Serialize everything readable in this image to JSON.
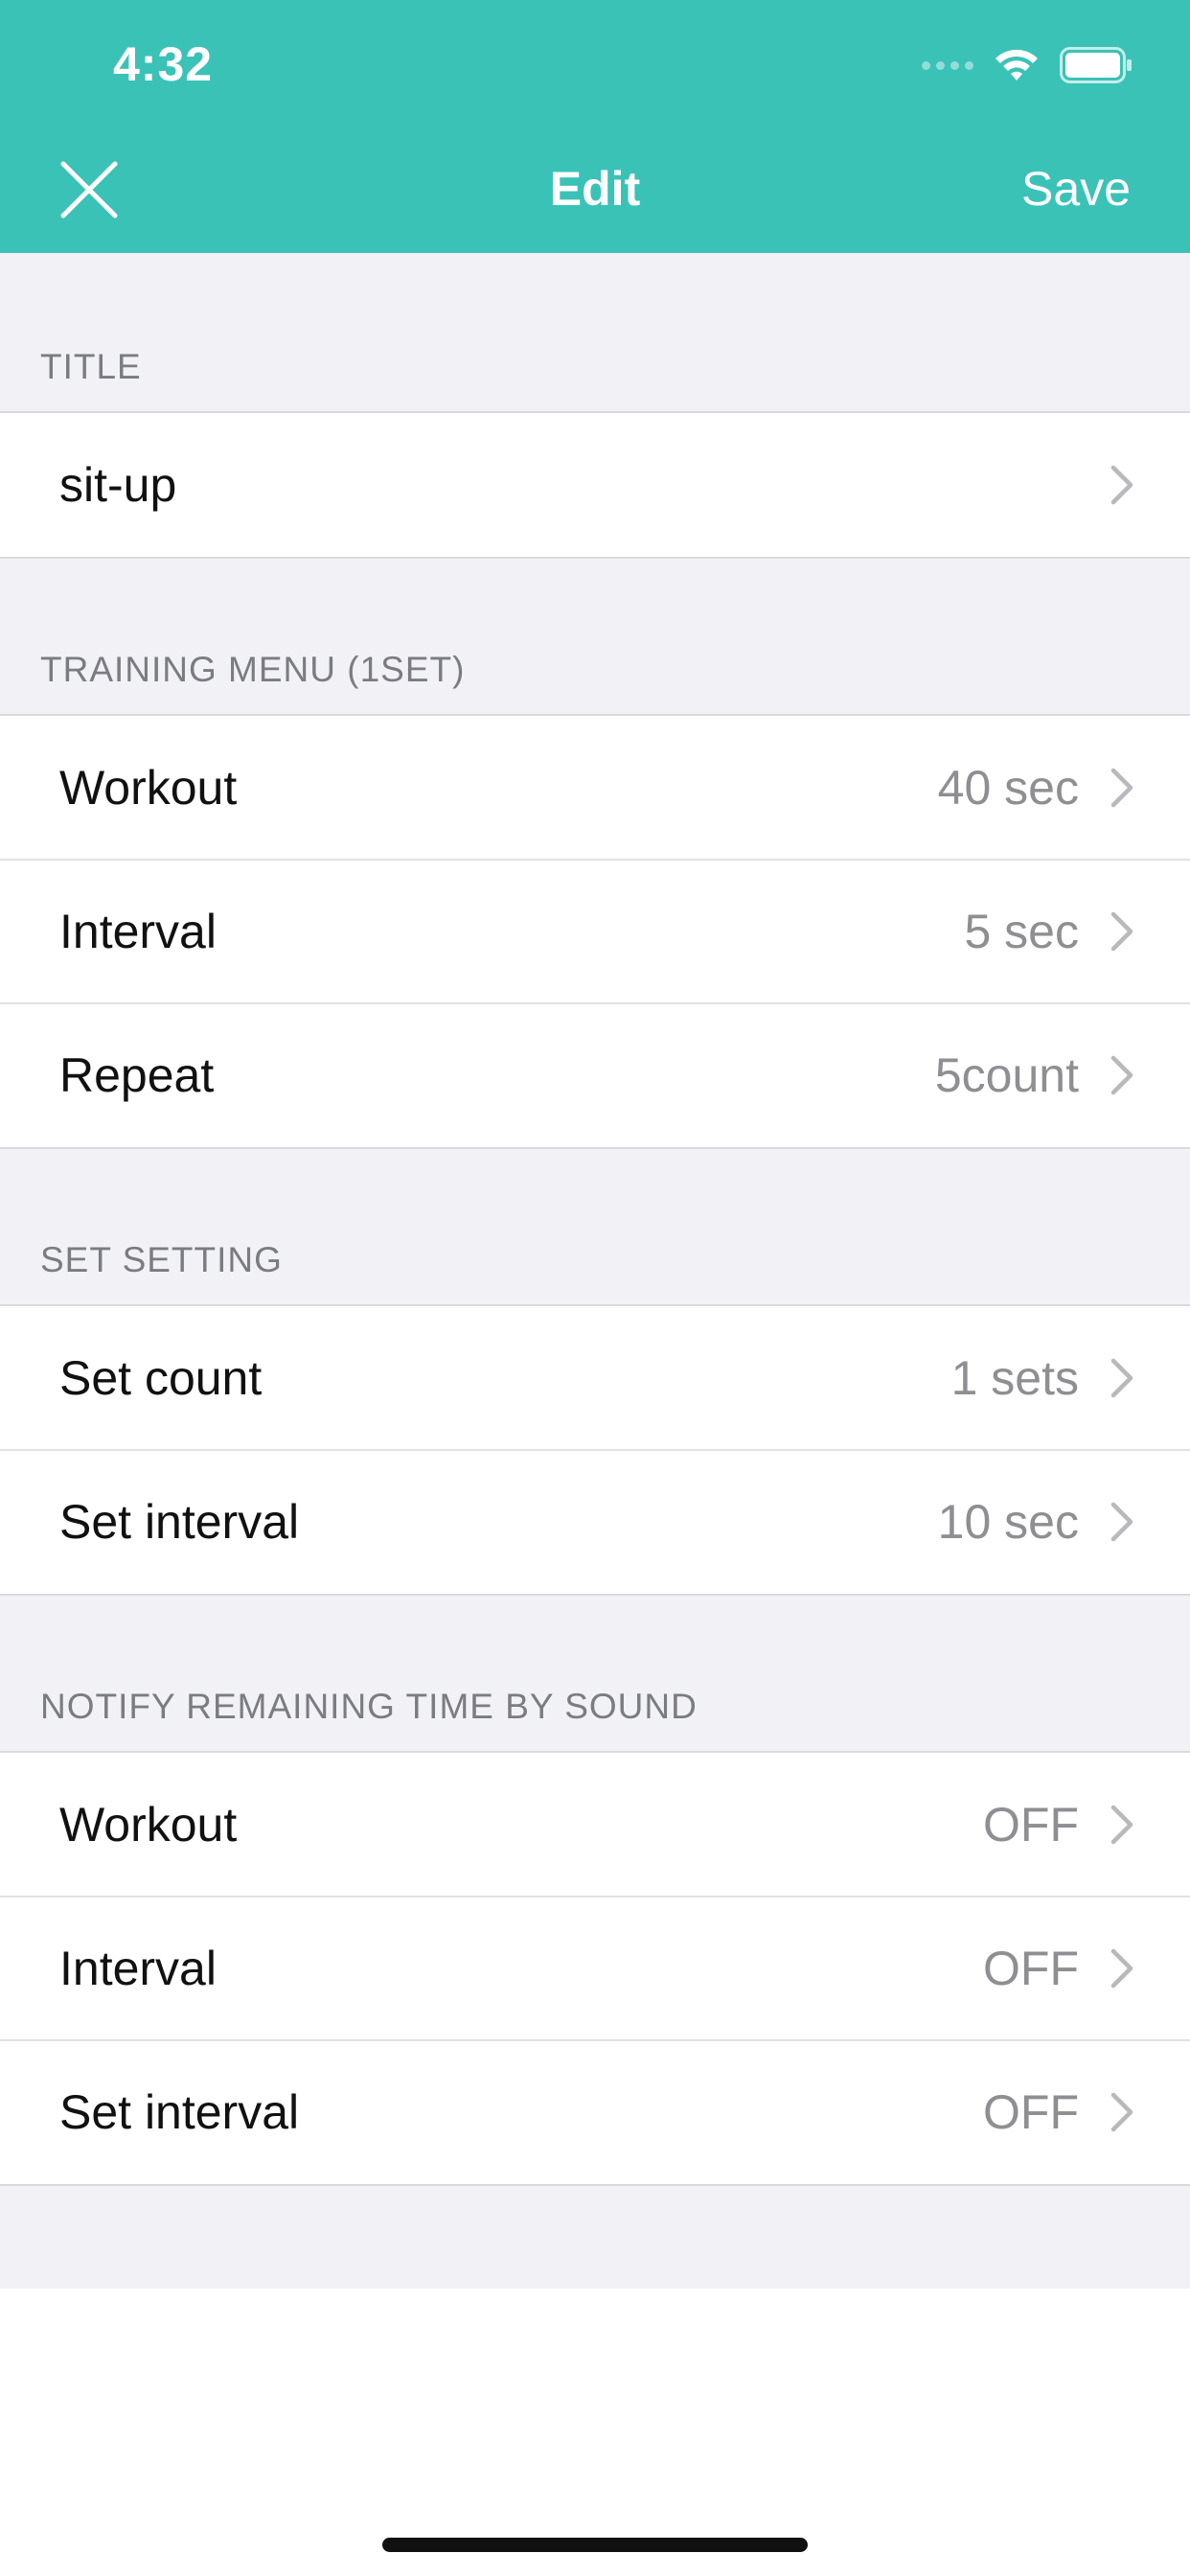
{
  "status_bar": {
    "time": "4:32"
  },
  "nav": {
    "title": "Edit",
    "save_label": "Save"
  },
  "sections": {
    "title": {
      "header": "TITLE",
      "rows": [
        {
          "label": "sit-up",
          "value": ""
        }
      ]
    },
    "training_menu": {
      "header": "TRAINING MENU (1SET)",
      "rows": [
        {
          "label": "Workout",
          "value": "40 sec"
        },
        {
          "label": "Interval",
          "value": "5 sec"
        },
        {
          "label": "Repeat",
          "value": "5count"
        }
      ]
    },
    "set_setting": {
      "header": "SET SETTING",
      "rows": [
        {
          "label": "Set count",
          "value": "1 sets"
        },
        {
          "label": "Set interval",
          "value": "10 sec"
        }
      ]
    },
    "notify": {
      "header": "NOTIFY REMAINING TIME BY SOUND",
      "rows": [
        {
          "label": "Workout",
          "value": "OFF"
        },
        {
          "label": "Interval",
          "value": "OFF"
        },
        {
          "label": "Set interval",
          "value": "OFF"
        }
      ]
    }
  },
  "colors": {
    "header_bg": "#3bc2b7",
    "list_bg": "#f1f1f6",
    "value_text": "#8e8e93"
  },
  "icons": {
    "close": "close-icon",
    "chevron": "chevron-right-icon",
    "wifi": "wifi-icon",
    "battery": "battery-icon"
  }
}
